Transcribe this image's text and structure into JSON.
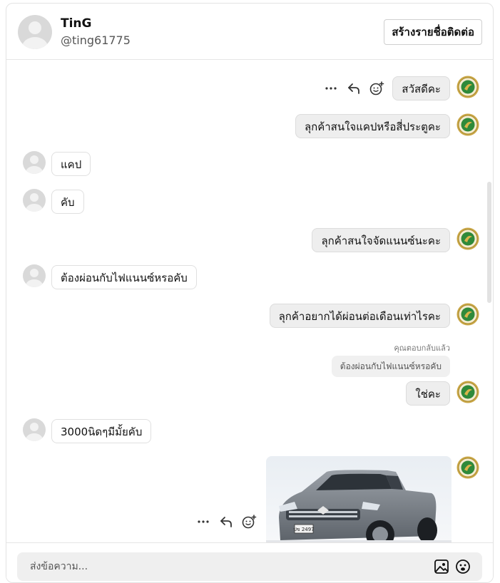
{
  "header": {
    "name": "TinG",
    "handle": "@ting61775",
    "create_contact_label": "สร้างรายชื่อติดต่อ"
  },
  "messages": [
    {
      "direction": "outgoing",
      "text": "สวัสดีคะ"
    },
    {
      "direction": "outgoing",
      "text": "ลุกค้าสนใจแคปหรือสี่ประตูคะ"
    },
    {
      "direction": "incoming",
      "text": "แคป"
    },
    {
      "direction": "incoming",
      "text": "คับ"
    },
    {
      "direction": "outgoing",
      "text": "ลุกค้าสนใจจัดแนนซ์นะคะ"
    },
    {
      "direction": "incoming",
      "text": "ต้องผ่อนกับไฟแนนซ์หรอคับ"
    },
    {
      "direction": "outgoing",
      "text": "ลุกค้าอยากได้ผ่อนต่อเดือนเท่าไรคะ"
    },
    {
      "direction": "outgoing",
      "reply_caption": "คุณตอบกลับแล้ว",
      "quoted": "ต้องผ่อนกับไฟแนนซ์หรอคับ",
      "text": "ใช่คะ"
    },
    {
      "direction": "incoming",
      "text": "3000นิดๆมีมั้ยคับ"
    },
    {
      "direction": "outgoing",
      "type": "image",
      "image": "pickup-truck-photo",
      "plate": "ปข 2497"
    }
  ],
  "composer": {
    "placeholder": "ส่งข้อความ..."
  },
  "icons": {
    "more": "more-dots-icon",
    "reply": "reply-arrow-icon",
    "react": "add-emoji-icon",
    "image_attach": "image-attach-icon",
    "emoji": "emoji-icon"
  },
  "colors": {
    "outgoing_bubble": "#eeeeee",
    "incoming_bubble": "#ffffff",
    "logo_gold": "#c9a646",
    "logo_green": "#2f8a3a"
  }
}
